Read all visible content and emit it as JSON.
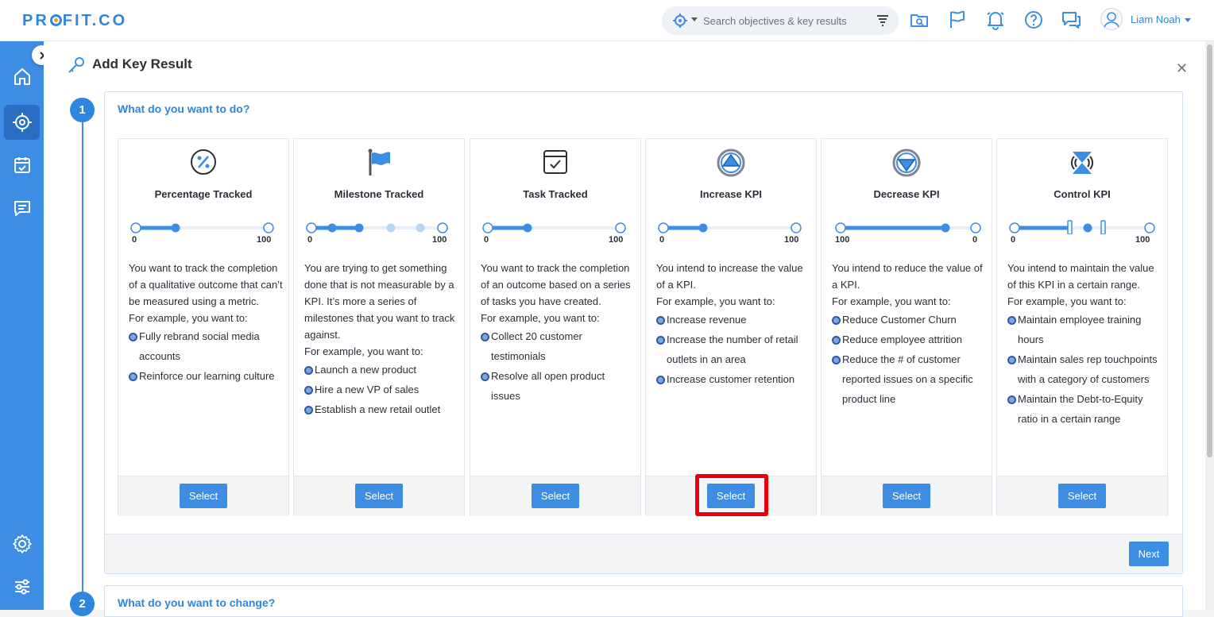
{
  "app": {
    "logo": "PROFIT.CO"
  },
  "header": {
    "search_placeholder": "Search objectives & key results",
    "user_name": "Liam Noah"
  },
  "page": {
    "title": "Add Key Result"
  },
  "steps": [
    {
      "number": "1",
      "question": "What do you want to do?",
      "next_label": "Next"
    },
    {
      "number": "2",
      "question": "What do you want to change?"
    }
  ],
  "cards": [
    {
      "title": "Percentage Tracked",
      "icon": "percent-icon",
      "slider": {
        "start": "0",
        "end": "100"
      },
      "desc": [
        "You want to track the completion of a qualitative outcome that can’t be measured using a metric.",
        "For example, you want to:"
      ],
      "bullets": [
        "Fully rebrand social media accounts",
        "Reinforce our learning culture"
      ],
      "button": "Select"
    },
    {
      "title": "Milestone Tracked",
      "icon": "flag-icon",
      "slider": {
        "start": "0",
        "end": "100"
      },
      "desc": [
        "You are trying to get something done that is not measurable by a KPI. It’s more a series of milestones that you want to track against.",
        "For example, you want to:"
      ],
      "bullets": [
        "Launch a new product",
        "Hire a new VP of sales",
        "Establish a new retail outlet"
      ],
      "button": "Select"
    },
    {
      "title": "Task Tracked",
      "icon": "task-icon",
      "slider": {
        "start": "0",
        "end": "100"
      },
      "desc": [
        "You want to track the completion of an outcome based on a series of tasks you have created.",
        "For example, you want to:"
      ],
      "bullets": [
        "Collect 20 customer testimonials",
        "Resolve all open product issues"
      ],
      "button": "Select"
    },
    {
      "title": "Increase KPI",
      "icon": "increase-icon",
      "slider": {
        "start": "0",
        "end": "100"
      },
      "desc": [
        "You intend to increase the value of a KPI.",
        "For example, you want to:"
      ],
      "bullets": [
        "Increase revenue",
        "Increase the number of retail outlets in an area",
        "Increase customer retention"
      ],
      "button": "Select"
    },
    {
      "title": "Decrease KPI",
      "icon": "decrease-icon",
      "slider": {
        "start": "100",
        "end": "0"
      },
      "desc": [
        "You intend to reduce the value of a KPI.",
        "For example, you want to:"
      ],
      "bullets": [
        "Reduce Customer Churn",
        "Reduce employee attrition",
        "Reduce the # of customer reported issues on a specific product line"
      ],
      "button": "Select"
    },
    {
      "title": "Control KPI",
      "icon": "control-icon",
      "slider": {
        "start": "0",
        "end": "100"
      },
      "desc": [
        "You intend to maintain the value of this KPI in a certain range.",
        "For example, you want to:"
      ],
      "bullets": [
        "Maintain employee training hours",
        "Maintain sales rep touchpoints with a category of customers",
        "Maintain the Debt-to-Equity ratio in a certain range"
      ],
      "button": "Select"
    }
  ],
  "colors": {
    "accent": "#3d8de5",
    "highlight": "#e8000b"
  }
}
